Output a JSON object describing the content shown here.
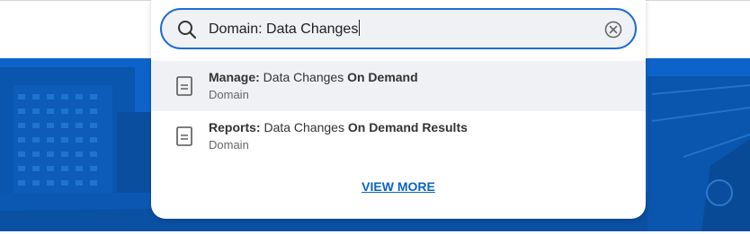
{
  "colors": {
    "accent": "#1a6dd6",
    "link": "#0b64c4",
    "hero_background": "#0d63c9",
    "highlight_row": "#eff1f4"
  },
  "search": {
    "value": "Domain: Data Changes",
    "placeholder": "",
    "icon": "search-icon",
    "clear_icon": "clear-icon"
  },
  "results": [
    {
      "icon": "document-icon",
      "title_parts": [
        {
          "text": "Manage:",
          "bold": true
        },
        {
          "text": " Data Changes ",
          "bold": false
        },
        {
          "text": "On Demand",
          "bold": true
        }
      ],
      "subtitle": "Domain",
      "highlighted": true
    },
    {
      "icon": "document-icon",
      "title_parts": [
        {
          "text": "Reports:",
          "bold": true
        },
        {
          "text": " Data Changes ",
          "bold": false
        },
        {
          "text": "On Demand Results",
          "bold": true
        }
      ],
      "subtitle": "Domain",
      "highlighted": false
    }
  ],
  "view_more_label": "VIEW MORE"
}
